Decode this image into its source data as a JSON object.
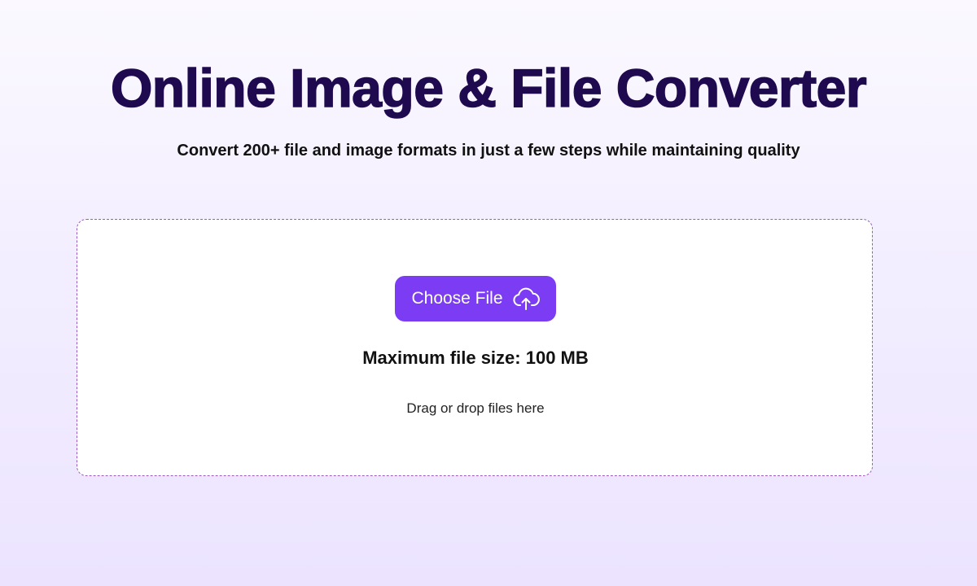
{
  "header": {
    "title": "Online Image & File Converter",
    "subtitle": "Convert 200+ file and image formats in just a few steps while maintaining quality"
  },
  "upload": {
    "choose_label": "Choose File",
    "choose_icon": "cloud-upload-icon",
    "max_size_text": "Maximum file size: 100 MB",
    "drag_hint": "Drag or drop files here"
  },
  "colors": {
    "title": "#1f0a4f",
    "accent": "#7b3cf3",
    "dropzone_border": "#9b59c8",
    "background_top": "#fbf9ff",
    "background_bottom": "#ece4ff"
  }
}
